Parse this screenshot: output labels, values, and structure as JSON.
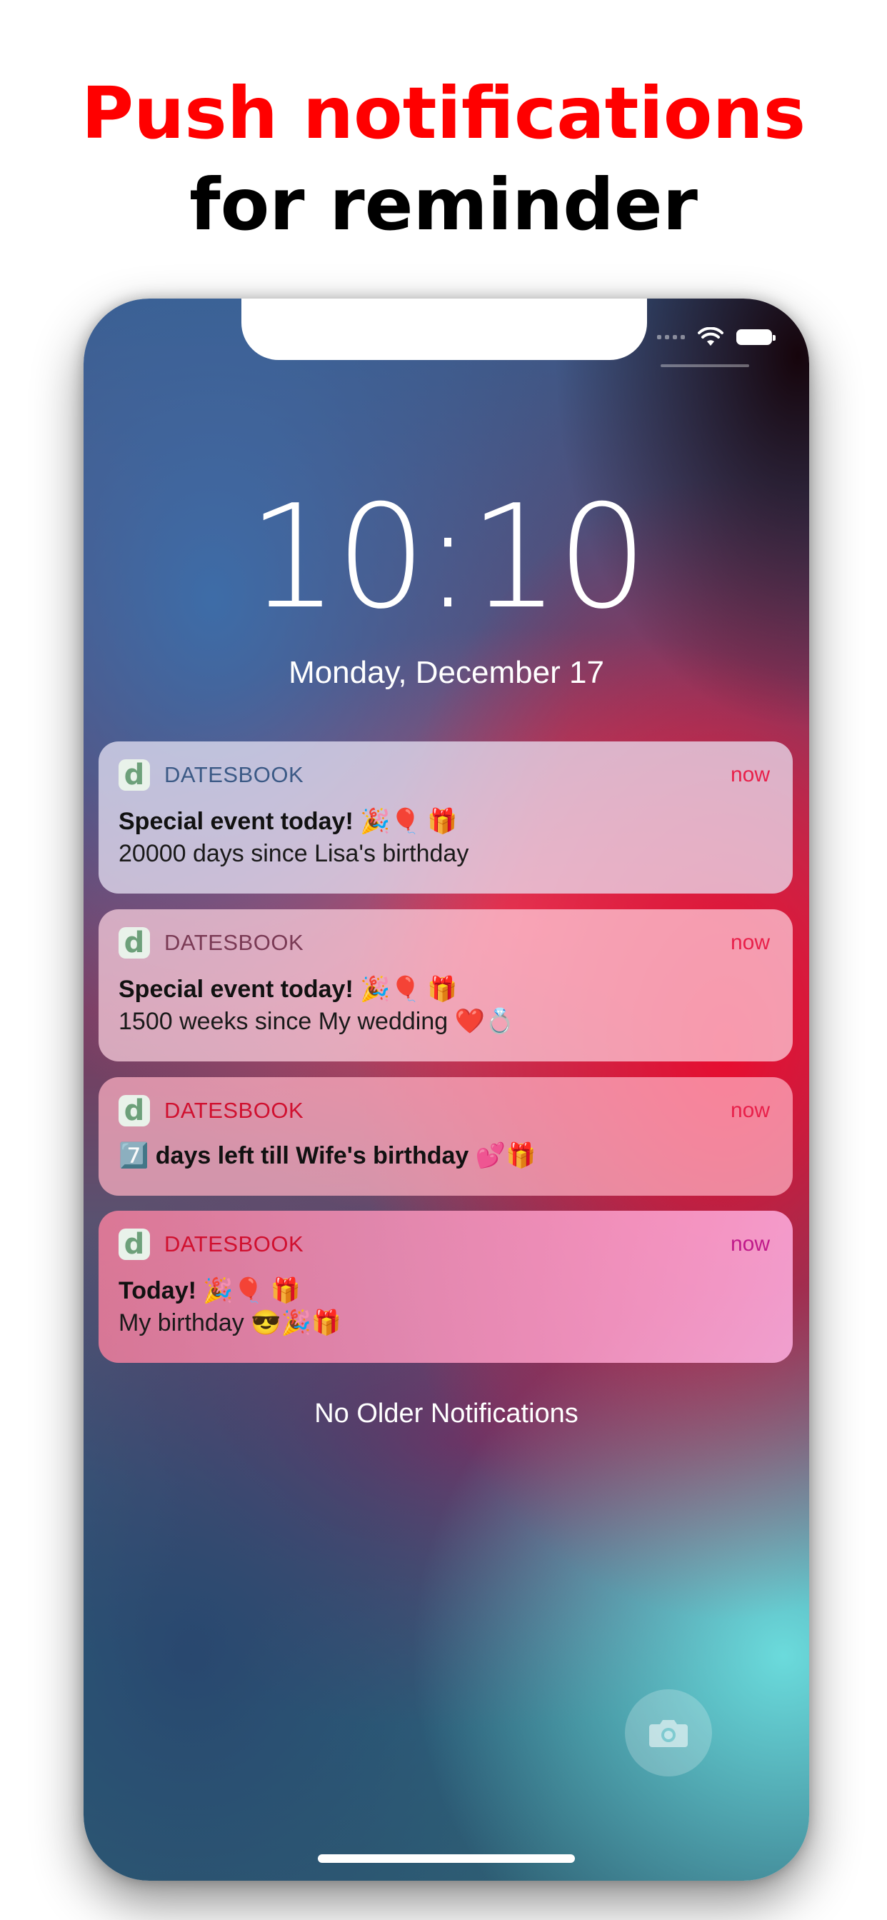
{
  "headline": {
    "line1": "Push notifications",
    "line2": "for reminder"
  },
  "lock_screen": {
    "time": "10:10",
    "date": "Monday, December 17",
    "footer": "No Older Notifications"
  },
  "colors": {
    "headline_accent": "#ff0000",
    "notification_time": "#e8204a"
  },
  "notifications": [
    {
      "app_icon": "d",
      "app_name": "DATESBOOK",
      "time": "now",
      "title": "Special event today! 🎉🎈 🎁",
      "body": "20000 days since Lisa's birthday"
    },
    {
      "app_icon": "d",
      "app_name": "DATESBOOK",
      "time": "now",
      "title": "Special event today! 🎉🎈 🎁",
      "body": "1500 weeks since My wedding ❤️💍"
    },
    {
      "app_icon": "d",
      "app_name": "DATESBOOK",
      "time": "now",
      "title": "7️⃣ days left till Wife's birthday 💕🎁"
    },
    {
      "app_icon": "d",
      "app_name": "DATESBOOK",
      "time": "now",
      "title": "Today! 🎉🎈 🎁",
      "body": "My birthday 😎🎉🎁"
    }
  ],
  "icons": {
    "status": [
      "signal-icon",
      "wifi-icon",
      "battery-icon"
    ],
    "quick_action": "camera-icon"
  }
}
